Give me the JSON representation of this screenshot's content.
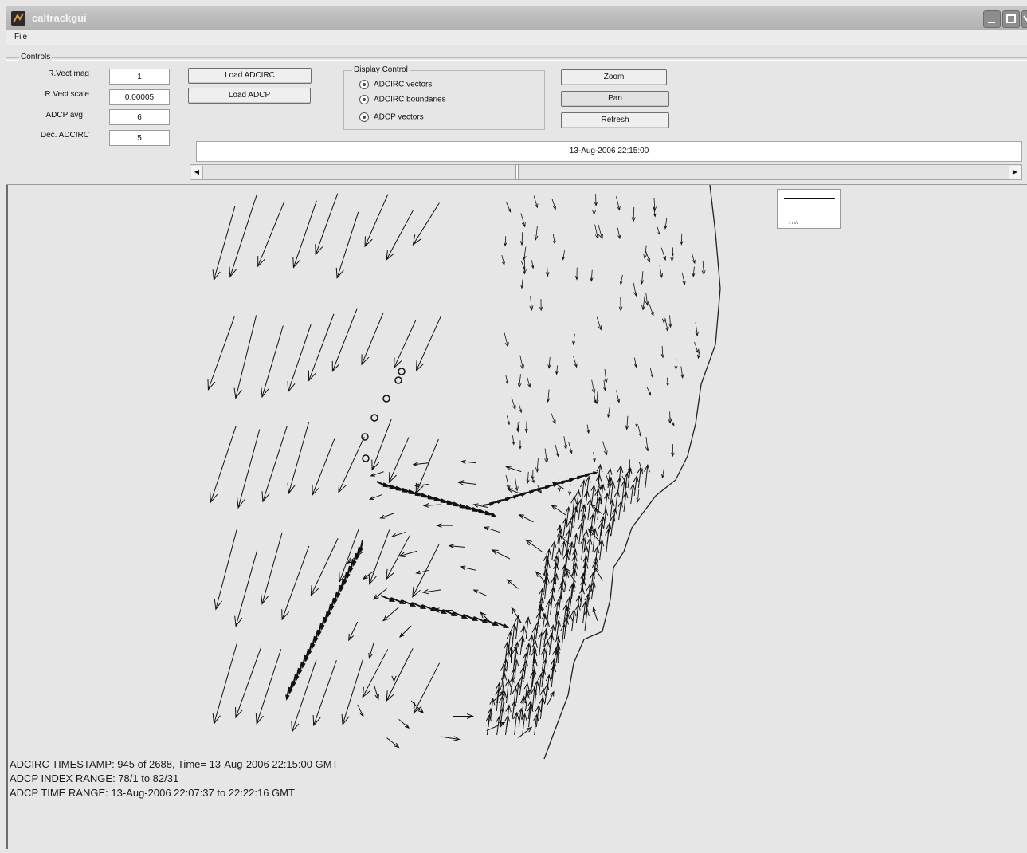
{
  "window": {
    "title": "caltrackgui"
  },
  "menu": {
    "file": "File"
  },
  "controls": {
    "label": "Controls",
    "params": [
      {
        "label": "R.Vect mag",
        "value": "1"
      },
      {
        "label": "R.Vect scale",
        "value": "0.00005"
      },
      {
        "label": "ADCP avg",
        "value": "6"
      },
      {
        "label": "Dec. ADCIRC",
        "value": "5"
      }
    ],
    "load_adcirc": "Load ADCIRC",
    "load_adcp": "Load ADCP",
    "zoom": "Zoom",
    "pan": "Pan",
    "refresh": "Refresh"
  },
  "display_control": {
    "title": "Display Control",
    "options": [
      "ADCIRC vectors",
      "ADCIRC boundaries",
      "ADCP vectors"
    ]
  },
  "timeline": {
    "timestamp": "13-Aug-2006 22:15:00",
    "slider_fraction": 0.39
  },
  "legend": {
    "scale_label": "1 m/s"
  },
  "info": {
    "line1": "ADCIRC TIMESTAMP: 945 of 2688, Time= 13-Aug-2006 22:15:00 GMT",
    "line2": "ADCP INDEX RANGE: 78/1 to 82/31",
    "line3": "ADCP TIME RANGE: 13-Aug-2006  22:07:37 to 22:22:16 GMT"
  },
  "colors": {
    "background": "#e6e6e6",
    "vectors": "#111111"
  }
}
